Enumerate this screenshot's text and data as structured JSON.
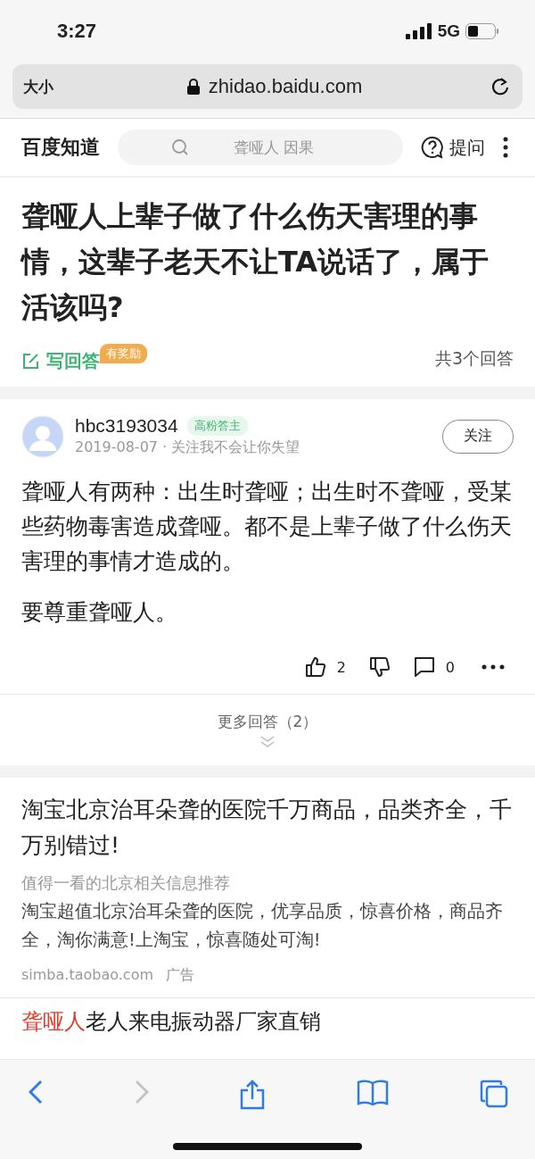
{
  "status_bar": {
    "time": "3:27",
    "network": "5G"
  },
  "browser": {
    "text_size": "大小",
    "url": "zhidao.baidu.com"
  },
  "header": {
    "logo": "百度知道",
    "search": {
      "placeholder": "聋哑人 因果"
    },
    "ask": "提问"
  },
  "question": {
    "title": "聋哑人上辈子做了什么伤天害理的事情，这辈子老天不让TA说话了，属于活该吗?",
    "write_answer": "写回答",
    "reward_badge": "有奖励",
    "answer_count": "共3个回答"
  },
  "answer": {
    "user": "hbc3193034",
    "user_badge": "高粉答主",
    "meta": "2019-08-07 · 关注我不会让你失望",
    "follow": "关注",
    "paragraphs": [
      "聋哑人有两种：出生时聋哑；出生时不聋哑，受某些药物毒害造成聋哑。都不是上辈子做了什么伤天害理的事情才造成的。",
      "要尊重聋哑人。"
    ],
    "likes": "2",
    "comments": "0"
  },
  "more_answers": "更多回答（2）",
  "ads": [
    {
      "title": "淘宝北京治耳朵聋的医院千万商品，品类齐全，千万别错过!",
      "subtitle": "值得一看的北京相关信息推荐",
      "description": "淘宝超值北京治耳朵聋的医院，优享品质，惊喜价格，商品齐全，淘你满意!上淘宝，惊喜随处可淘!",
      "source": "simba.taobao.com",
      "label": "广告"
    }
  ],
  "next_ad": {
    "highlight": "聋哑人",
    "title": "老人来电振动器厂家直销"
  },
  "toolbar": [
    {
      "kind": "back",
      "disabled": false
    },
    {
      "kind": "forward",
      "disabled": true
    },
    {
      "kind": "share",
      "disabled": false
    },
    {
      "kind": "bookmarks",
      "disabled": false
    },
    {
      "kind": "tabs",
      "disabled": false
    }
  ]
}
